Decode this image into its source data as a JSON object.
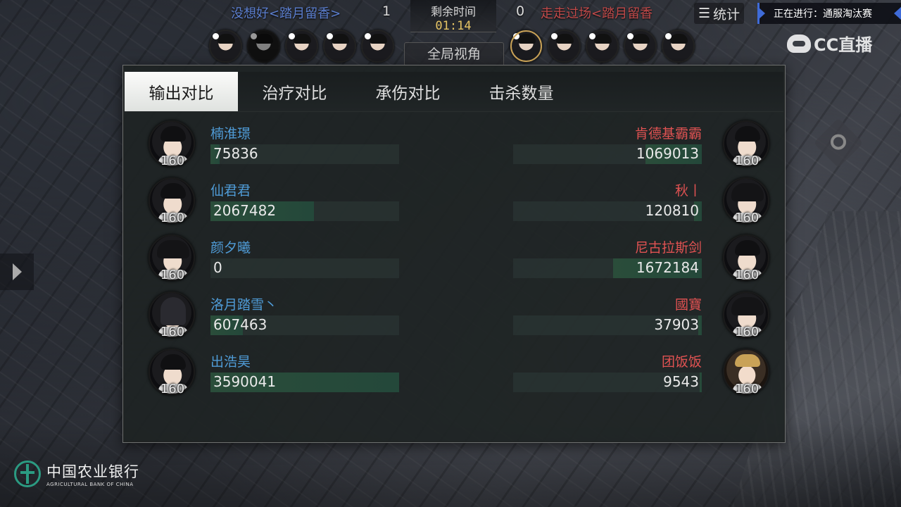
{
  "top": {
    "team_left_name": "没想好<踏月留香>",
    "team_left_score": "1",
    "timer_label": "剩余时间",
    "timer_value": "01:14",
    "team_right_score": "0",
    "team_right_name": "走走过场<踏月留香",
    "stats_label": "统计",
    "live_text": "正在进行：通服淘汰赛",
    "global_view_label": "全局视角"
  },
  "watermark": {
    "cc_text": "CC直播",
    "bank_cn": "中国农业银行",
    "bank_en": "AGRICULTURAL BANK OF CHINA"
  },
  "tabs": [
    "输出对比",
    "治疗对比",
    "承伤对比",
    "击杀数量"
  ],
  "active_tab": 0,
  "team_left": [
    {
      "name": "楠淮璟",
      "value": "75836",
      "level": "160",
      "ratio": 0.05
    },
    {
      "name": "仙君君",
      "value": "2067482",
      "level": "160",
      "ratio": 0.55
    },
    {
      "name": "颜夕曦",
      "value": "0",
      "level": "160",
      "ratio": 0.0
    },
    {
      "name": "洛月踏雪丶",
      "value": "607463",
      "level": "160",
      "ratio": 0.17
    },
    {
      "name": "出浩昊",
      "value": "3590041",
      "level": "160",
      "ratio": 1.0
    }
  ],
  "team_right": [
    {
      "name": "肯德基霸霸",
      "value": "1069013",
      "level": "160",
      "ratio": 0.3
    },
    {
      "name": "秋丨",
      "value": "120810",
      "level": "160",
      "ratio": 0.04
    },
    {
      "name": "尼古拉斯剑",
      "value": "1672184",
      "level": "160",
      "ratio": 0.47
    },
    {
      "name": "國寶",
      "value": "37903",
      "level": "160",
      "ratio": 0.02
    },
    {
      "name": "团饭饭",
      "value": "9543",
      "level": "160",
      "ratio": 0.01
    }
  ],
  "colors": {
    "left_team": "#4f9bd6",
    "right_team": "#e05252",
    "timer": "#e6c464",
    "bar_fill": "#2a4d3a"
  }
}
